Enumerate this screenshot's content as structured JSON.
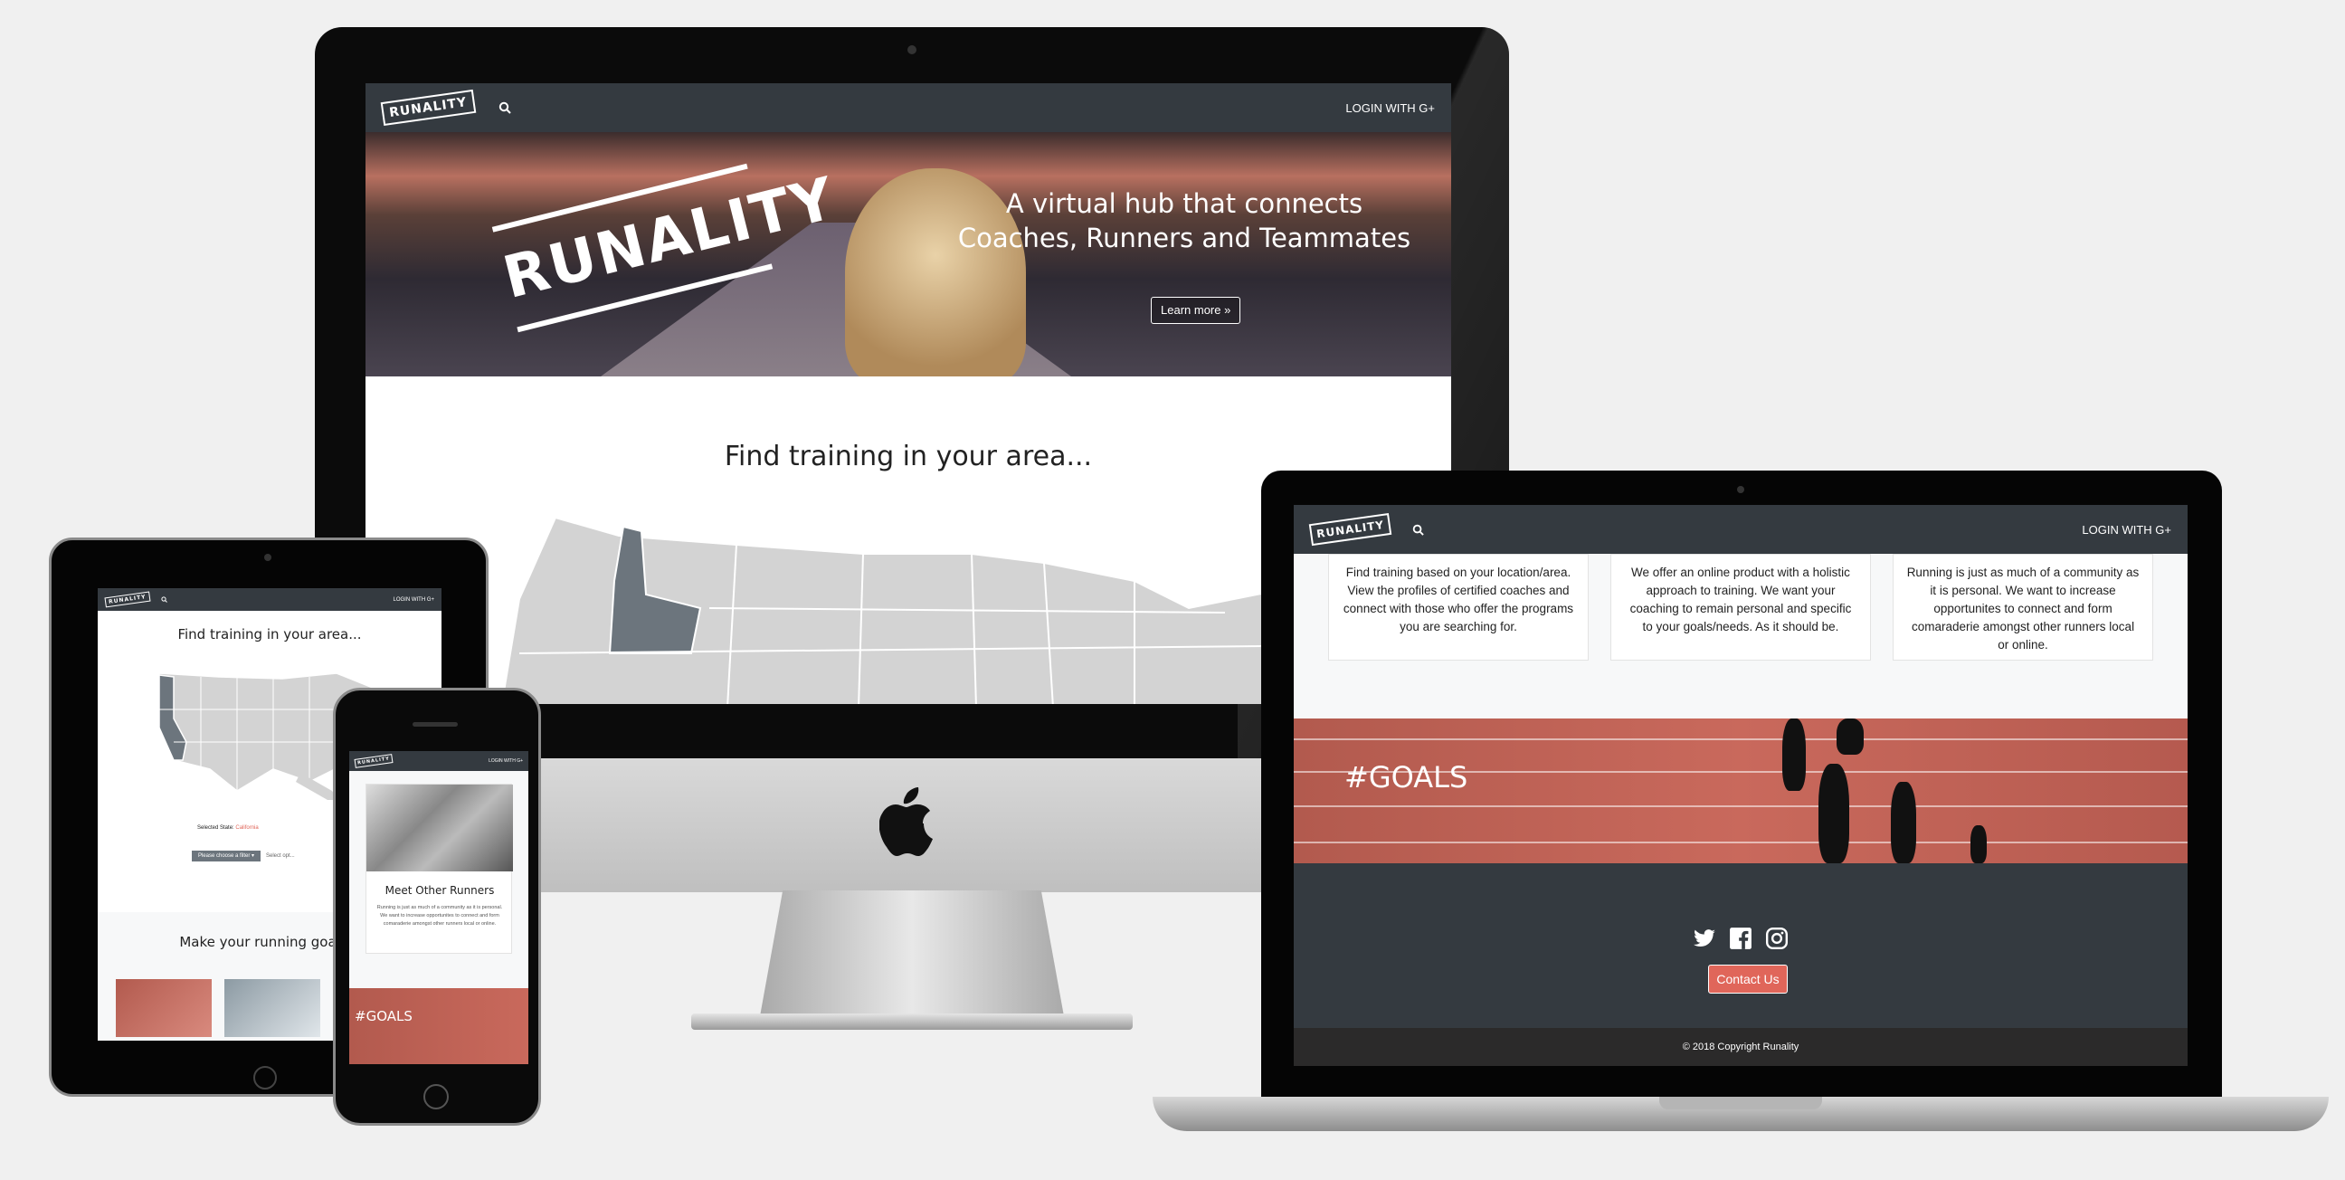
{
  "brand": {
    "name": "RUNALITY",
    "logo_small": "RUNALITY",
    "accent": "#e0665a",
    "nav_bg": "#343a40"
  },
  "nav": {
    "login_label": "LOGIN WITH G+",
    "search_icon": "search-icon"
  },
  "hero": {
    "logo": "RUNALITY",
    "tagline": "A virtual hub that connects Coaches, Runners and Teammates",
    "cta": "Learn more »"
  },
  "find_section": {
    "title": "Find training in your area..."
  },
  "features": [
    {
      "text": "Find training based on your location/area. View the profiles of certified coaches and connect with those who offer the programs you are searching for."
    },
    {
      "text": "We offer an online product with a holistic approach to training. We want your coaching to remain personal and specific to your goals/needs. As it should be."
    },
    {
      "text": "Running is just as much of a community as it is personal. We want to increase opportunites to connect and form comaraderie amongst other runners local or online."
    }
  ],
  "goals_banner": {
    "text": "#GOALS"
  },
  "footer": {
    "social": [
      "twitter-icon",
      "facebook-icon",
      "instagram-icon"
    ],
    "contact_label": "Contact Us",
    "copyright": "© 2018 Copyright Runality"
  },
  "tablet": {
    "find_title": "Find training in your area...",
    "selected_prefix": "Selected State:",
    "selected_value": "California",
    "filter_label": "Please choose a filter ▾",
    "filter_value": "Select opt...",
    "goals_title": "Make your running goals a"
  },
  "phone": {
    "card_title": "Meet Other Runners",
    "card_text": "Running is just as much of a community as it is personal. We want to increase opportunites to connect and form comaraderie amongst other runners local or online."
  }
}
